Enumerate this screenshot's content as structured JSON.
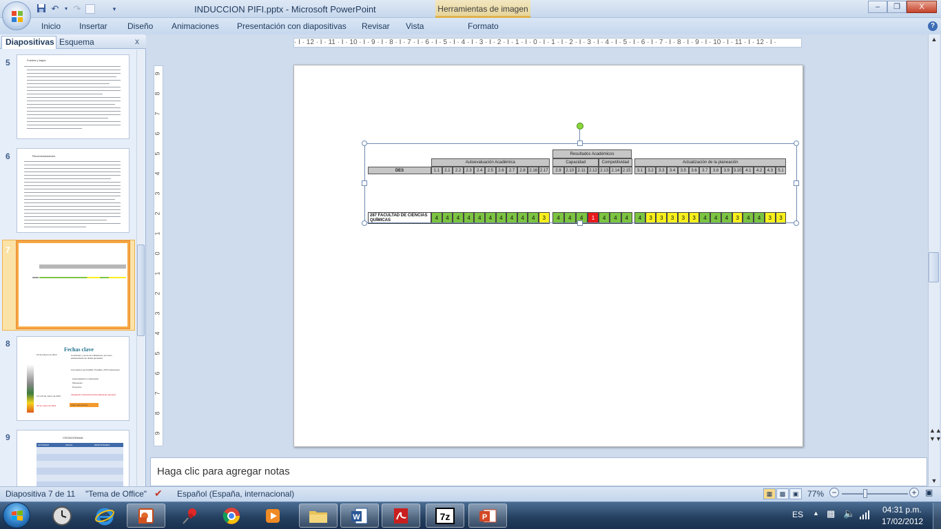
{
  "window": {
    "title": "INDUCCION PIFI.pptx - Microsoft PowerPoint",
    "context_tab_title": "Herramientas de imagen",
    "min": "–",
    "max": "❒",
    "close": "X"
  },
  "quick_access": [
    "save",
    "undo",
    "redo",
    "customize"
  ],
  "ribbon_tabs": [
    "Inicio",
    "Insertar",
    "Diseño",
    "Animaciones",
    "Presentación con diapositivas",
    "Revisar",
    "Vista",
    "Formato"
  ],
  "help": "?",
  "left_pane": {
    "tabs": {
      "slides": "Diapositivas",
      "outline": "Esquema"
    },
    "close": "x",
    "thumbnails": [
      {
        "number": "5",
        "title": "Fuertes y bajos"
      },
      {
        "number": "6",
        "title": "Recomendaciones"
      },
      {
        "number": "7",
        "title": ""
      },
      {
        "number": "8",
        "title": "Fechas clave",
        "date1": "15 de febrero de 2012",
        "date2": "12 a 29 de marzo de 2012",
        "date3": "30 de marzo de 2012",
        "items": [
          "Conclusión y cierre de indicadores, así como planteamiento de dudas generales.",
          "Formulación de ProDES, ProGES y PIFI Institucional",
          "Autoevaluación y planeación",
          "Planeación",
          "Proyectos",
          "Integración institucional (acuerdamiento general)",
          "Cierre del proceso"
        ]
      },
      {
        "number": "9",
        "title": "CRONOGRAMA",
        "columns": [
          "ACTIVIDAD",
          "FECHA",
          "RESPONSABLE"
        ]
      }
    ]
  },
  "ruler": {
    "horizontal": "· I · 12 · I · 11 · I · 10 · I · 9 · I · 8 · I · 7 · I · 6 · I · 5 · I · 4 · I · 3 · I · 2 · I · 1 · I · 0 · I · 1 · I · 2 · I · 3 · I · 4 · I · 5 · I · 6 · I · 7 · I · 8 · I · 9 · I · 10 · I · 11 · I · 12 · I ·",
    "vertical": [
      "9",
      "8",
      "7",
      "6",
      "5",
      "4",
      "3",
      "2",
      "1",
      "0",
      "1",
      "2",
      "3",
      "4",
      "5",
      "6",
      "7",
      "8",
      "9"
    ]
  },
  "slide_table": {
    "top_header": "Resultados Académicos",
    "groups": [
      "Autoevaluación Académica",
      "Capacidad",
      "Competitividad",
      "Actualización de la planeación"
    ],
    "des_label": "DES",
    "columns_g1": [
      "1.1",
      "2.1",
      "2.2",
      "2.3",
      "2.4",
      "2.5",
      "2.6",
      "2.7",
      "2.8",
      "2.16",
      "2.17"
    ],
    "columns_g2": [
      "2.9",
      "2.10",
      "2.11",
      "2.12"
    ],
    "columns_g3": [
      "2.13",
      "2.14",
      "2.15"
    ],
    "columns_g4": [
      "3.1",
      "3.2",
      "3.3",
      "3.4",
      "3.5",
      "3.6",
      "3.7",
      "3.8",
      "3.9",
      "3.10",
      "4.1",
      "4.2",
      "4.3",
      "5.1"
    ],
    "row_label": "287 FACULTAD DE CIENCIAS QUÍMICAS",
    "values_g1": [
      "4",
      "4",
      "4",
      "4",
      "4",
      "4",
      "4",
      "4",
      "4",
      "4",
      "3"
    ],
    "values_g2": [
      "4",
      "4",
      "4",
      "1"
    ],
    "values_g3": [
      "4",
      "4",
      "4"
    ],
    "values_g4": [
      "4",
      "3",
      "3",
      "3",
      "3",
      "3",
      "4",
      "4",
      "4",
      "3",
      "4",
      "4",
      "3",
      "3"
    ],
    "colors": {
      "4": "#7cc441",
      "3": "#f8f01c",
      "1": "#e8191c"
    }
  },
  "notes_placeholder": "Haga clic para agregar notas",
  "status": {
    "slide": "Diapositiva 7 de 11",
    "theme": "\"Tema de Office\"",
    "language": "Español (España, internacional)",
    "zoom": "77%",
    "zoom_minus": "−",
    "zoom_plus": "+"
  },
  "tray": {
    "lang": "ES",
    "time": "04:31 p.m.",
    "date": "17/02/2012"
  },
  "taskbar_apps": [
    "Reloj",
    "Internet Explorer",
    "PowerPoint presentación",
    "Pin",
    "Chrome",
    "Media",
    "Explorador",
    "Word",
    "Adobe PDF",
    "7-Zip",
    "PowerPoint"
  ]
}
